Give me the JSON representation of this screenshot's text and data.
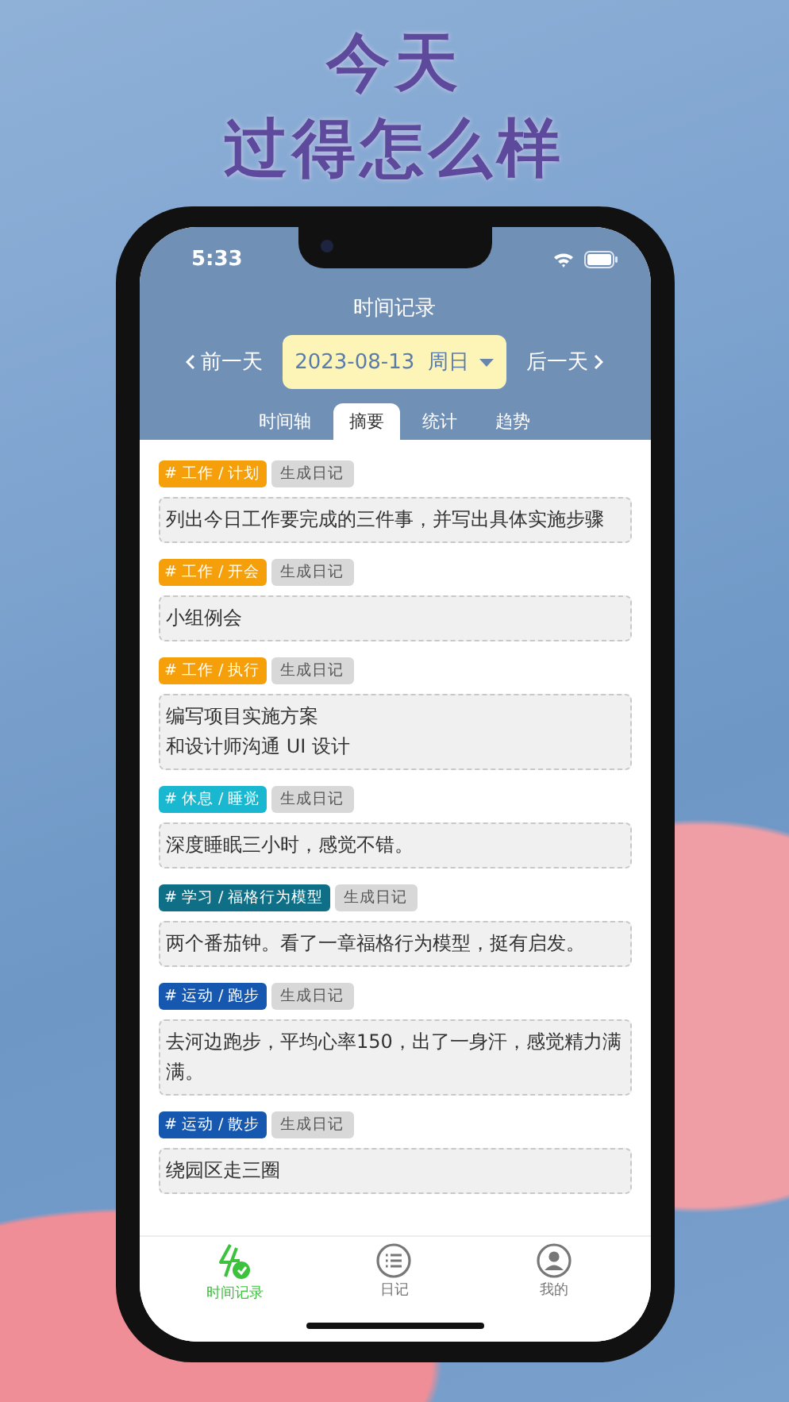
{
  "headline": [
    "今天",
    "过得怎么样"
  ],
  "status_bar": {
    "time": "5:33"
  },
  "header": {
    "title": "时间记录",
    "prev": "前一天",
    "date": "2023-08-13  周日",
    "next": "后一天"
  },
  "tabs": [
    {
      "label": "时间轴",
      "selected": false
    },
    {
      "label": "摘要",
      "selected": true
    },
    {
      "label": "统计",
      "selected": false
    },
    {
      "label": "趋势",
      "selected": false
    }
  ],
  "entries": [
    {
      "tag": "# 工作 / 计划",
      "color": "#f5a00a",
      "action": "生成日记",
      "text": "列出今日工作要完成的三件事，并写出具体实施步骤"
    },
    {
      "tag": "# 工作 / 开会",
      "color": "#f5a00a",
      "action": "生成日记",
      "text": "小组例会"
    },
    {
      "tag": "# 工作 / 执行",
      "color": "#f5a00a",
      "action": "生成日记",
      "text": "编写项目实施方案",
      "text_line_2": "和设计师沟通 UI 设计"
    },
    {
      "tag": "# 休息 / 睡觉",
      "color": "#1ab8d0",
      "action": "生成日记",
      "text": "深度睡眠三小时，感觉不错。"
    },
    {
      "tag": "# 学习 / 福格行为模型",
      "color": "#0e6f86",
      "action": "生成日记",
      "text": "两个番茄钟。看了一章福格行为模型，挺有启发。"
    },
    {
      "tag": "# 运动 / 跑步",
      "color": "#1657b0",
      "action": "生成日记",
      "text": "去河边跑步，平均心率150，出了一身汗，感觉精力满满。"
    },
    {
      "tag": "# 运动 / 散步",
      "color": "#1657b0",
      "action": "生成日记",
      "text": "绕园区走三圈"
    }
  ],
  "bottom_nav": [
    {
      "kind": "record",
      "label": "时间记录",
      "selected": true
    },
    {
      "kind": "diary",
      "label": "日记",
      "selected": false
    },
    {
      "kind": "profile",
      "label": "我的",
      "selected": false
    }
  ]
}
